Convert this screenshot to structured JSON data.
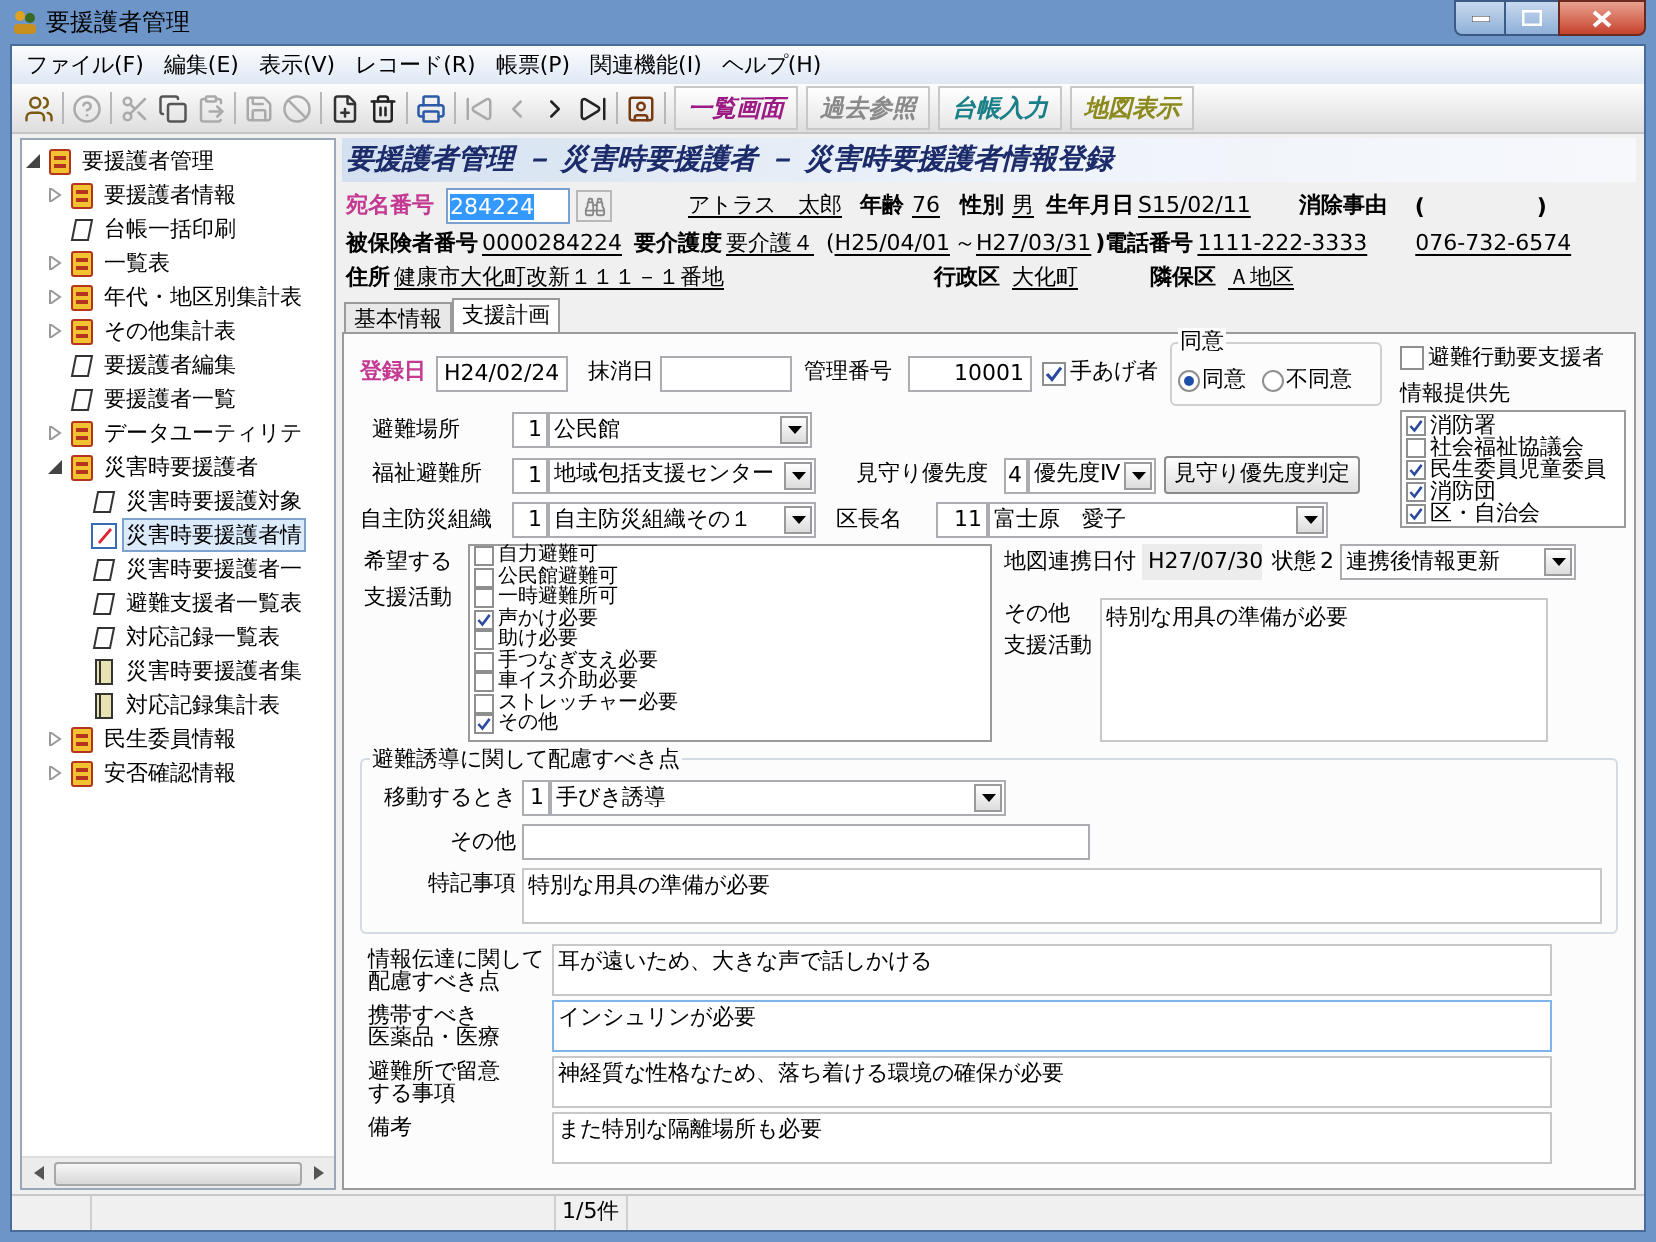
{
  "window": {
    "title": "要援護者管理"
  },
  "menu": [
    "ファイル(F)",
    "編集(E)",
    "表示(V)",
    "レコード(R)",
    "帳票(P)",
    "関連機能(I)",
    "ヘルプ(H)"
  ],
  "toolbar_buttons": [
    {
      "label": "一覧画面",
      "color": "#9b1a83"
    },
    {
      "label": "過去参照",
      "color": "#8a8a8a"
    },
    {
      "label": "台帳入力",
      "color": "#1a7f86"
    },
    {
      "label": "地図表示",
      "color": "#8c8a1c"
    }
  ],
  "tree": {
    "items": [
      {
        "label": "要援護者管理",
        "kind": "group",
        "expanded": true,
        "selected": false,
        "children": [
          {
            "label": "要援護者情報",
            "kind": "group",
            "expanded": false,
            "selected": false
          },
          {
            "label": "台帳一括印刷",
            "kind": "page",
            "selected": false
          },
          {
            "label": "一覧表",
            "kind": "group",
            "expanded": false,
            "selected": false
          },
          {
            "label": "年代・地区別集計表",
            "kind": "group",
            "expanded": false,
            "selected": false
          },
          {
            "label": "その他集計表",
            "kind": "group",
            "expanded": false,
            "selected": false
          },
          {
            "label": "要援護者編集",
            "kind": "page",
            "selected": false
          },
          {
            "label": "要援護者一覧",
            "kind": "page",
            "selected": false
          },
          {
            "label": "データユーティリテ",
            "kind": "group",
            "expanded": false,
            "selected": false
          },
          {
            "label": "災害時要援護者",
            "kind": "group",
            "expanded": true,
            "selected": false,
            "children": [
              {
                "label": "災害時要援護対象",
                "kind": "page",
                "selected": false
              },
              {
                "label": "災害時要援護者情",
                "kind": "edit",
                "selected": true
              },
              {
                "label": "災害時要援護者一",
                "kind": "page",
                "selected": false
              },
              {
                "label": "避難支援者一覧表",
                "kind": "page",
                "selected": false
              },
              {
                "label": "対応記録一覧表",
                "kind": "page",
                "selected": false
              },
              {
                "label": "災害時要援護者集",
                "kind": "report",
                "selected": false
              },
              {
                "label": "対応記録集計表",
                "kind": "report",
                "selected": false
              }
            ]
          },
          {
            "label": "民生委員情報",
            "kind": "group",
            "expanded": false,
            "selected": false
          },
          {
            "label": "安否確認情報",
            "kind": "group",
            "expanded": false,
            "selected": false
          }
        ]
      }
    ]
  },
  "heading": "要援護者管理 － 災害時要援護者 － 災害時要援護者情報登録",
  "person": {
    "atena_label": "宛名番号",
    "atena": "284224",
    "name": "アトラス　太郎",
    "age_label": "年齢",
    "age": "76",
    "sex_label": "性別",
    "sex": "男",
    "birth_label": "生年月日",
    "birth": "S15/02/11",
    "deletion_label": "消除事由",
    "deletion_open": "(",
    "deletion_close": ")",
    "insured_label": "被保険者番号",
    "insured": "0000284224",
    "care_label": "要介護度",
    "care": "要介護４",
    "period_open": "(",
    "period_from": "H25/04/01",
    "period_sep": "～",
    "period_to": "H27/03/31",
    "period_close": ")",
    "phone_label": "電話番号",
    "phone": "1111-222-3333",
    "phone2": "076-732-6574",
    "address_label": "住所",
    "address": "健康市大化町改新１１１－１番地",
    "ward_label": "行政区",
    "ward": "大化町",
    "district_label": "隣保区",
    "district": "Ａ地区"
  },
  "tabs": [
    {
      "label": "基本情報",
      "selected": false
    },
    {
      "label": "支援計画",
      "selected": true
    }
  ],
  "form": {
    "registered": {
      "label": "登録日",
      "value": "H24/02/24"
    },
    "deleted": {
      "label": "抹消日"
    },
    "manage": {
      "label": "管理番号",
      "value": "10001"
    },
    "raise_hand": {
      "label": "手あげ者",
      "checked": true
    },
    "consent": {
      "legend": "同意",
      "options": [
        {
          "label": "同意",
          "selected": true
        },
        {
          "label": "不同意",
          "selected": false
        }
      ]
    },
    "evac_support": {
      "label": "避難行動要支援者",
      "checked": false
    },
    "providers": {
      "label": "情報提供先",
      "items": [
        {
          "label": "消防署",
          "checked": true
        },
        {
          "label": "社会福祉協議会",
          "checked": false
        },
        {
          "label": "民生委員児童委員",
          "checked": true
        },
        {
          "label": "消防団",
          "checked": true
        },
        {
          "label": "区・自治会",
          "checked": true
        }
      ]
    },
    "shelter": {
      "label": "避難場所",
      "code": "1",
      "value": "公民館"
    },
    "welfare": {
      "label": "福祉避難所",
      "code": "1",
      "value": "地域包括支援センター"
    },
    "priority": {
      "label": "見守り優先度",
      "code": "4",
      "value": "優先度Ⅳ"
    },
    "judge_button": "見守り優先度判定",
    "org": {
      "label": "自主防災組織",
      "code": "1",
      "value": "自主防災組織その１"
    },
    "chief": {
      "label": "区長名",
      "code": "11",
      "value": "富士原　愛子"
    },
    "activities": {
      "label_lines": [
        "希望する",
        "支援活動"
      ],
      "items": [
        {
          "label": "自力避難可",
          "checked": false
        },
        {
          "label": "公民館避難可",
          "checked": false
        },
        {
          "label": "一時避難所可",
          "checked": false
        },
        {
          "label": "声かけ必要",
          "checked": true
        },
        {
          "label": "助け必要",
          "checked": false
        },
        {
          "label": "手つなぎ支え必要",
          "checked": false
        },
        {
          "label": "車イス介助必要",
          "checked": false
        },
        {
          "label": "ストレッチャー必要",
          "checked": false
        },
        {
          "label": "その他",
          "checked": true
        }
      ]
    },
    "map_link": {
      "label": "地図連携日付",
      "value": "H27/07/30"
    },
    "status": {
      "label": "状態",
      "code": "2",
      "value": "連携後情報更新"
    },
    "other_support": {
      "label_lines": [
        "その他",
        "支援活動"
      ],
      "value": "特別な用具の準備が必要"
    },
    "guidance": {
      "legend": "避難誘導に関して配慮すべき点",
      "moving": {
        "label": "移動するとき",
        "code": "1",
        "value": "手びき誘導"
      },
      "other": {
        "label": "その他"
      },
      "notes": {
        "label": "特記事項",
        "value": "特別な用具の準備が必要"
      }
    },
    "remarks": [
      {
        "label_lines": [
          "情報伝達に関して",
          "配慮すべき点"
        ],
        "value": "耳が遠いため、大きな声で話しかける",
        "focused": false
      },
      {
        "label_lines": [
          "携帯すべき",
          "医薬品・医療"
        ],
        "value": "インシュリンが必要",
        "focused": true
      },
      {
        "label_lines": [
          "避難所で留意",
          "する事項"
        ],
        "value": "神経質な性格なため、落ち着ける環境の確保が必要",
        "focused": false
      },
      {
        "label_lines": [
          "備考"
        ],
        "value": "また特別な隔離場所も必要",
        "focused": false
      }
    ]
  },
  "status_bar": {
    "count": "1/5件"
  }
}
